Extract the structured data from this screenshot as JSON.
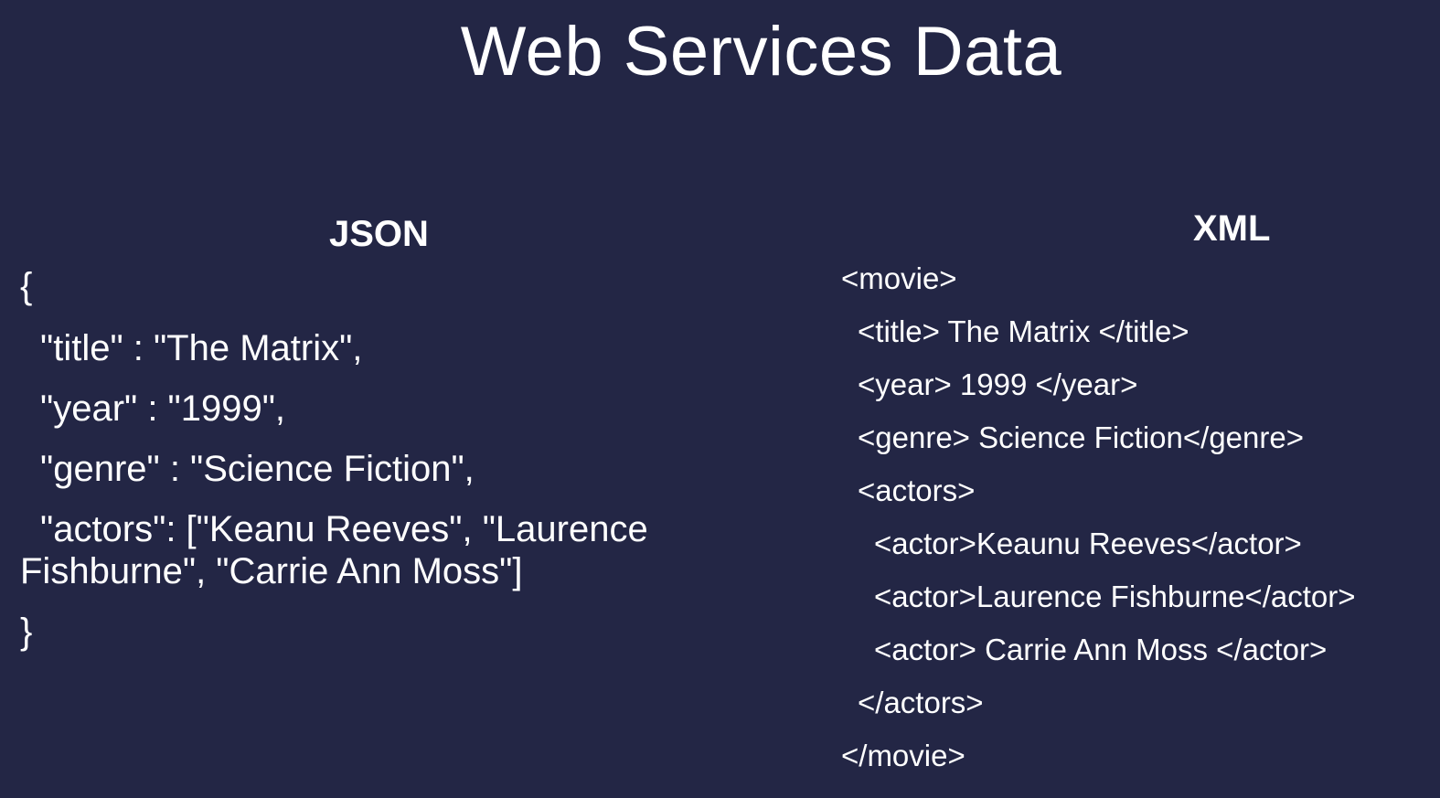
{
  "slide": {
    "title": "Web Services Data"
  },
  "json_panel": {
    "heading": "JSON",
    "lines": [
      "{",
      "\"title\" : \"The Matrix\",",
      "\"year\" : \"1999\",",
      "\"genre\" : \"Science Fiction\",",
      "\"actors\": [\"Keanu Reeves\", \"Laurence Fishburne\", \"Carrie Ann Moss\"]",
      "}"
    ]
  },
  "xml_panel": {
    "heading": "XML",
    "lines": [
      "<movie>",
      "<title> The Matrix </title>",
      "<year> 1999 </year>",
      "<genre> Science Fiction</genre>",
      "<actors>",
      "<actor>Keaunu Reeves</actor>",
      "<actor>Laurence Fishburne</actor>",
      "<actor> Carrie Ann Moss </actor>",
      "</actors>",
      "</movie>"
    ]
  }
}
